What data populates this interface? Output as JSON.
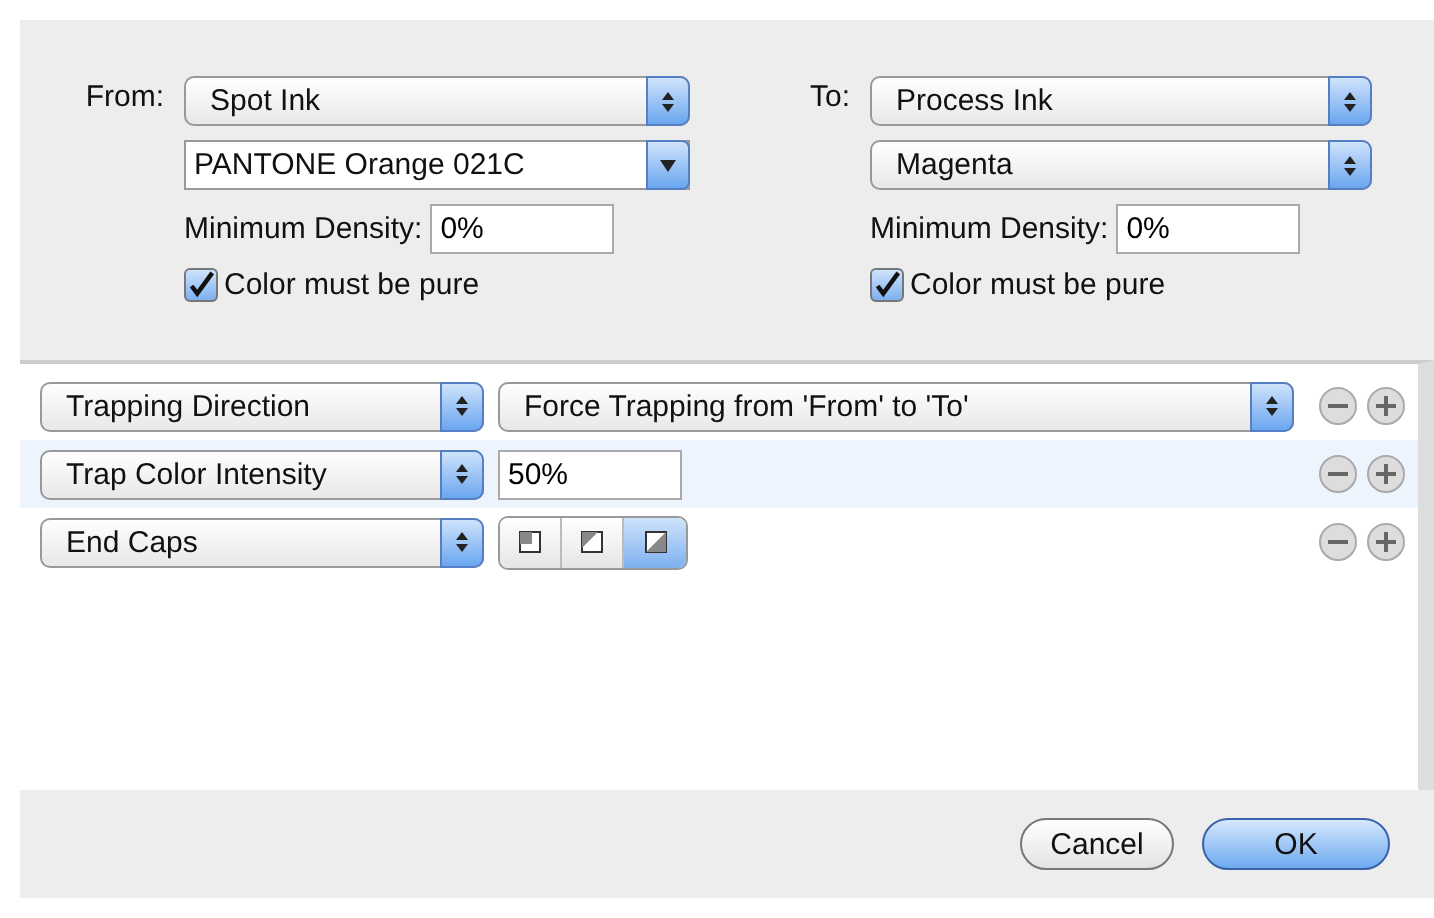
{
  "from": {
    "label": "From:",
    "menus": [
      {
        "kind": "popup",
        "value": "Spot Ink"
      },
      {
        "kind": "combo",
        "value": "PANTONE Orange 021C"
      }
    ],
    "density_label": "Minimum Density:",
    "density": "0%",
    "pure": {
      "label": "Color must be pure",
      "checked": true
    }
  },
  "to": {
    "label": "To:",
    "menus": [
      {
        "kind": "popup",
        "value": "Process Ink"
      },
      {
        "kind": "popup",
        "value": "Magenta"
      }
    ],
    "density_label": "Minimum Density:",
    "density": "0%",
    "pure": {
      "label": "Color must be pure",
      "checked": true
    }
  },
  "rules": [
    {
      "attribute": "Trapping Direction",
      "kind": "popup",
      "value": "Force Trapping from 'From' to 'To'",
      "selected": false
    },
    {
      "attribute": "Trap Color Intensity",
      "kind": "field",
      "value": "50%",
      "selected": true
    },
    {
      "attribute": "End Caps",
      "kind": "segments",
      "segments": [
        {
          "selected": false
        },
        {
          "selected": false
        },
        {
          "selected": true
        }
      ],
      "selected": false
    }
  ],
  "buttons": [
    {
      "label": "Cancel",
      "default": false
    },
    {
      "label": "OK",
      "default": true
    }
  ]
}
